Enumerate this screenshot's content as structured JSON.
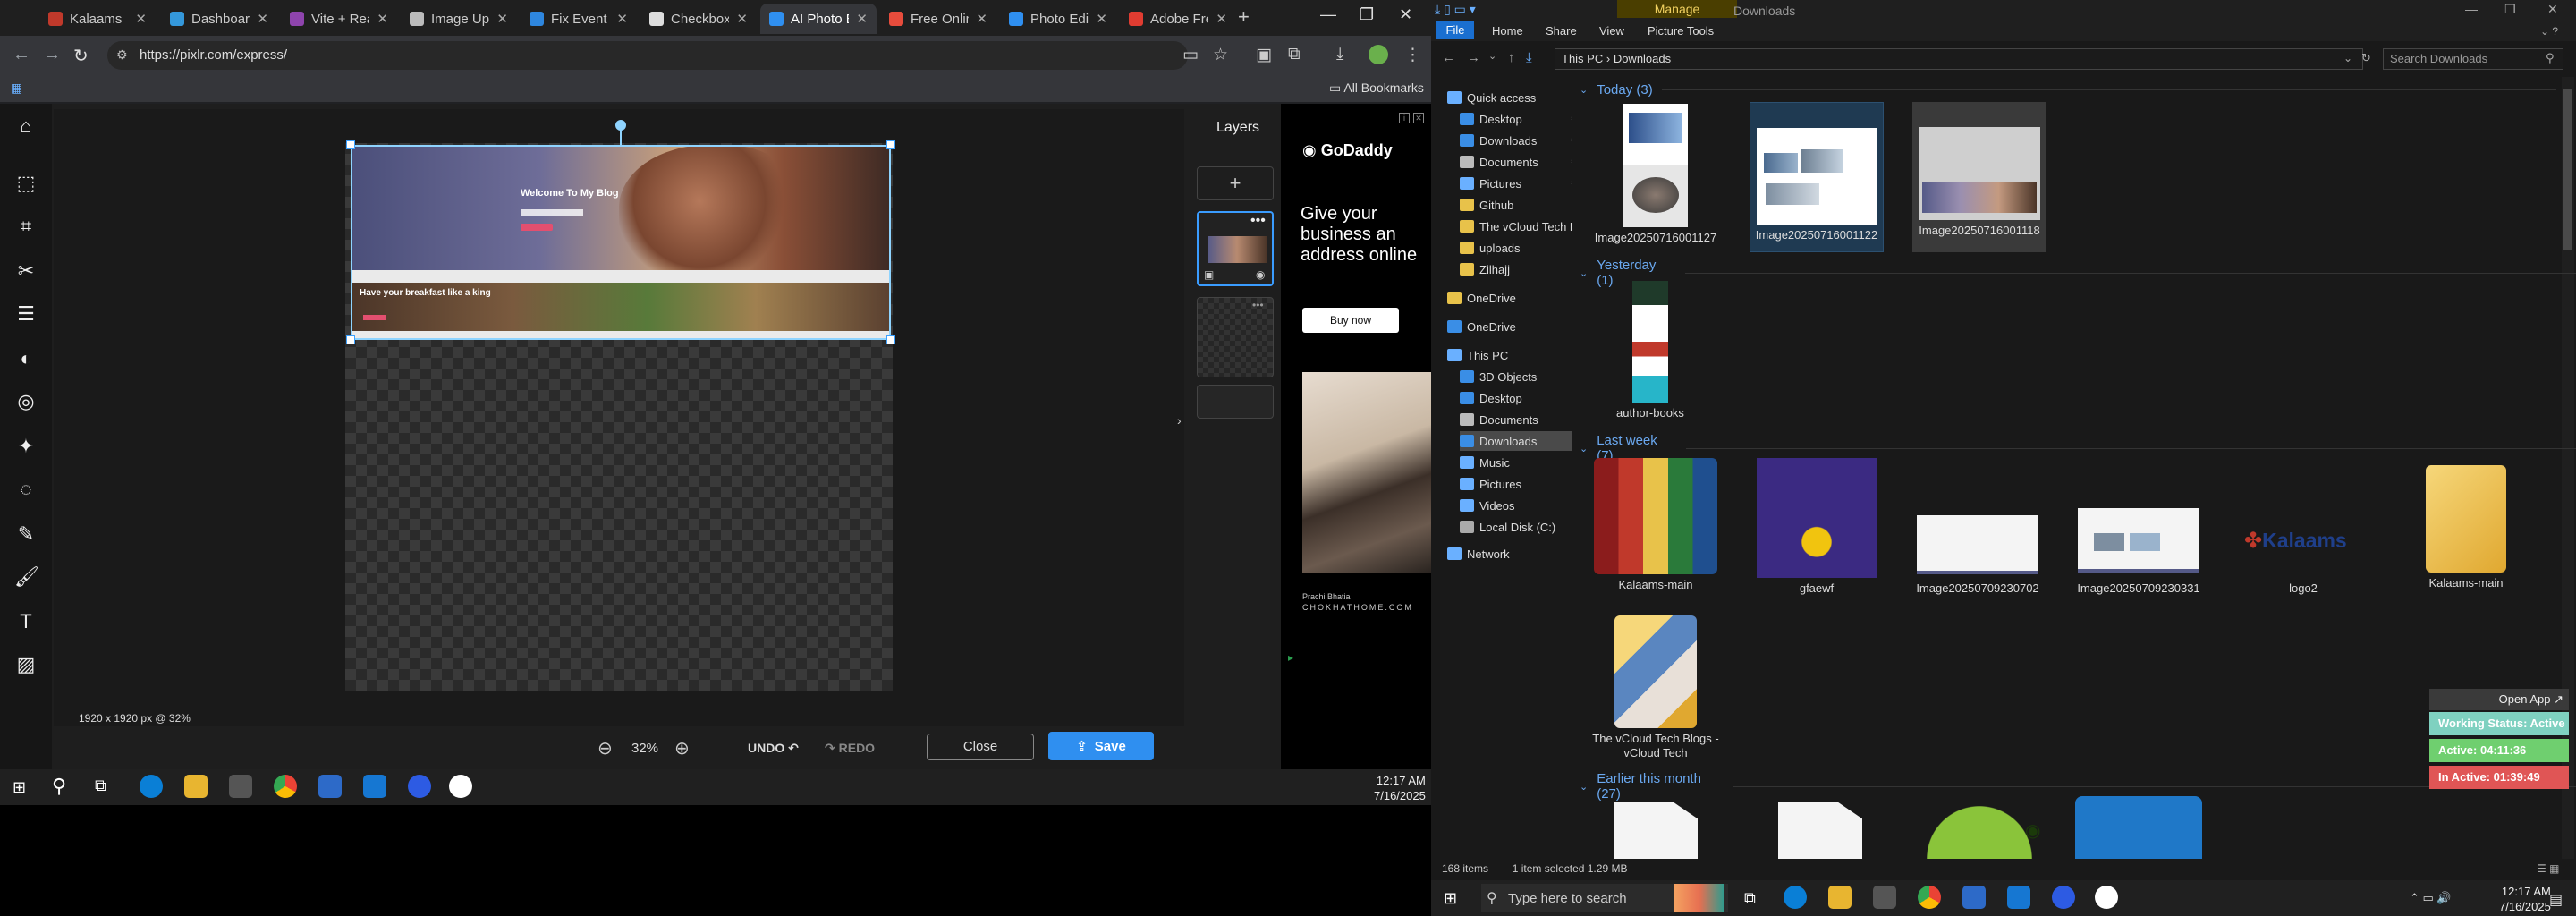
{
  "chrome": {
    "tabs": [
      {
        "label": "Kalaams",
        "color": "#c0392b"
      },
      {
        "label": "Dashboard",
        "color": "#3498db"
      },
      {
        "label": "Vite + React",
        "color": "#8e44ad"
      },
      {
        "label": "Image Uploader",
        "color": "#bbbbbb"
      },
      {
        "label": "Fix Event Sub",
        "color": "#2e86de"
      },
      {
        "label": "Checkbox",
        "color": "#dddddd"
      },
      {
        "label": "AI Photo Editor",
        "color": "#2f8ff0"
      },
      {
        "label": "Free Online",
        "color": "#e74c3c"
      },
      {
        "label": "Photo Editor",
        "color": "#2f8ff0"
      },
      {
        "label": "Adobe Free",
        "color": "#e03c31"
      }
    ],
    "url": "https://pixlr.com/express/",
    "all_bookmarks": "All Bookmarks"
  },
  "pixlr": {
    "layers_title": "Layers",
    "hero_title": "Welcome To My Blog",
    "strip_title": "Have your breakfast like a king",
    "size_info": "1920 x 1920 px @ 32%",
    "zoom": "32%",
    "undo": "UNDO",
    "redo": "REDO",
    "close": "Close",
    "save": "Save",
    "accent": "#2f8ff0"
  },
  "ad": {
    "brand": "GoDaddy",
    "headline": "Give your business an address online",
    "button": "Buy now",
    "caption_name": "Prachi Bhatia",
    "caption_site": "CHOKHATHOME.COM"
  },
  "taskbar_left": {
    "time": "12:17 AM",
    "date": "7/16/2025"
  },
  "explorer": {
    "manage": "Manage",
    "title": "Downloads",
    "ribbon_tabs": [
      "File",
      "Home",
      "Share",
      "View",
      "Picture Tools"
    ],
    "path": [
      "This PC",
      "Downloads"
    ],
    "search_placeholder": "Search Downloads",
    "nav": [
      {
        "label": "Quick access",
        "kind": "star"
      },
      {
        "label": "Desktop",
        "kind": "blue",
        "pin": true
      },
      {
        "label": "Downloads",
        "kind": "down",
        "pin": true
      },
      {
        "label": "Documents",
        "kind": "doc",
        "pin": true
      },
      {
        "label": "Pictures",
        "kind": "pic",
        "pin": true
      },
      {
        "label": "Github",
        "kind": "folder"
      },
      {
        "label": "The vCloud Tech Blogs",
        "kind": "folder"
      },
      {
        "label": "uploads",
        "kind": "folder"
      },
      {
        "label": "Zilhajj",
        "kind": "folder"
      },
      {
        "label": "OneDrive",
        "kind": "folder"
      },
      {
        "label": "OneDrive",
        "kind": "cloud"
      },
      {
        "label": "This PC",
        "kind": "pc"
      },
      {
        "label": "3D Objects",
        "kind": "blue"
      },
      {
        "label": "Desktop",
        "kind": "blue"
      },
      {
        "label": "Documents",
        "kind": "doc"
      },
      {
        "label": "Downloads",
        "kind": "down",
        "selected": true
      },
      {
        "label": "Music",
        "kind": "music"
      },
      {
        "label": "Pictures",
        "kind": "pic"
      },
      {
        "label": "Videos",
        "kind": "video"
      },
      {
        "label": "Local Disk (C:)",
        "kind": "disk"
      },
      {
        "label": "Network",
        "kind": "net"
      }
    ],
    "groups": {
      "today": "Today (3)",
      "yesterday": "Yesterday (1)",
      "last_week": "Last week (7)",
      "earlier": "Earlier this month (27)"
    },
    "today_files": [
      "Image20250716001127",
      "Image20250716001122",
      "Image20250716001118"
    ],
    "yesterday_files": [
      "author-books"
    ],
    "last_week_files": [
      "Kalaams-main",
      "gfaewf",
      "Image20250709230702",
      "Image20250709230331",
      "logo2",
      "Kalaams-main",
      "The vCloud Tech Blogs - vCloud Tech"
    ],
    "logo_text": "Kalaams",
    "status_items": "168 items",
    "status_selected": "1 item selected  1.29 MB"
  },
  "tracker": {
    "open_app": "Open App ↗",
    "working": "Working Status: Active",
    "active": "Active: 04:11:36",
    "inactive": "In Active: 01:39:49"
  },
  "taskbar_right": {
    "search": "Type here to search",
    "time": "12:17 AM",
    "date": "7/16/2025"
  }
}
